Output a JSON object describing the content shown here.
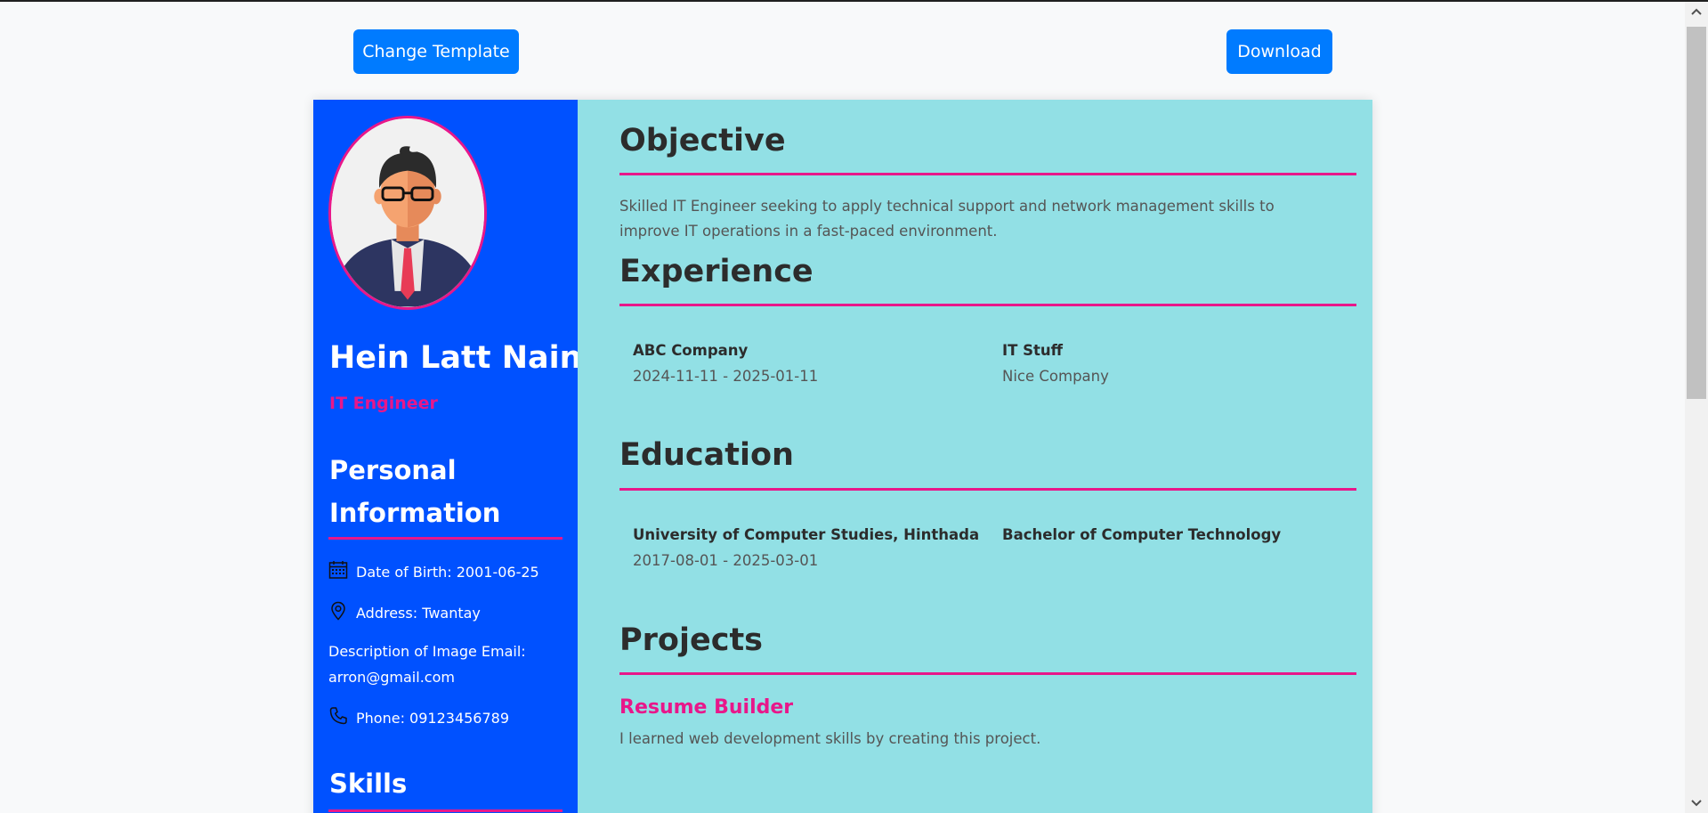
{
  "toolbar": {
    "change_template_label": "Change Template",
    "download_label": "Download"
  },
  "sidebar": {
    "name": "Hein Latt Naing",
    "role": "IT Engineer",
    "personal_heading": "Personal Information",
    "dob": "Date of Birth: 2001-06-25",
    "address": "Address: Twantay",
    "email": "Description of Image  Email: arron@gmail.com",
    "phone": "Phone: 09123456789",
    "skills_heading": "Skills"
  },
  "main": {
    "objective_heading": "Objective",
    "objective_text": "Skilled IT Engineer seeking to apply technical support and network management skills to improve IT operations in a fast-paced environment.",
    "experience_heading": "Experience",
    "experience": {
      "company": "ABC Company",
      "dates": "2024-11-11 - 2025-01-11",
      "position": "IT Stuff",
      "description": "Nice Company"
    },
    "education_heading": "Education",
    "education": {
      "school": "University of Computer Studies, Hinthada",
      "dates": "2017-08-01 - 2025-03-01",
      "degree": "Bachelor of Computer Technology"
    },
    "projects_heading": "Projects",
    "project": {
      "title": "Resume Builder",
      "description": "I learned web development skills by creating this project."
    }
  },
  "icons": {
    "dob": "calendar-icon",
    "address": "location-pin-icon",
    "phone": "phone-icon"
  },
  "colors": {
    "button": "#007bff",
    "sidebar": "#0051ff",
    "main": "#92e0e5",
    "accent": "#e8178a"
  }
}
